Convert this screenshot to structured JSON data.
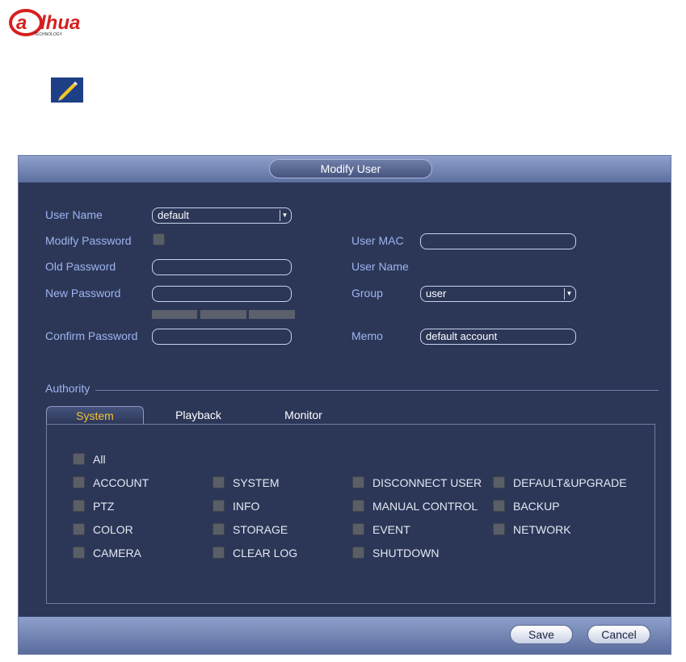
{
  "logo": {
    "brand": "alhua",
    "sub": "TECHNOLOGY",
    "color": "#d62020"
  },
  "dialog": {
    "title": "Modify User",
    "labels": {
      "user_name": "User Name",
      "modify_password": "Modify Password",
      "old_password": "Old Password",
      "new_password": "New Password",
      "confirm_password": "Confirm Password",
      "user_mac": "User MAC",
      "user_name_right": "User Name",
      "group": "Group",
      "memo": "Memo",
      "authority": "Authority"
    },
    "values": {
      "user_name": "default",
      "old_password": "",
      "new_password": "",
      "confirm_password": "",
      "user_mac": "",
      "group": "user",
      "memo": "default account"
    },
    "tabs": [
      "System",
      "Playback",
      "Monitor"
    ],
    "active_tab": "System",
    "permissions": {
      "all": "All",
      "col1": [
        "ACCOUNT",
        "PTZ",
        "COLOR",
        "CAMERA"
      ],
      "col2": [
        "SYSTEM",
        "INFO",
        "STORAGE",
        "CLEAR LOG"
      ],
      "col3": [
        "DISCONNECT USER",
        "MANUAL CONTROL",
        "EVENT",
        "SHUTDOWN"
      ],
      "col4": [
        "DEFAULT&UPGRADE",
        "BACKUP",
        "NETWORK"
      ]
    },
    "buttons": {
      "save": "Save",
      "cancel": "Cancel"
    }
  },
  "icons": {
    "edit": "pencil-icon",
    "dropdown": "chevron-down-icon"
  },
  "colors": {
    "dialog_bg": "#2c3758",
    "label": "#9fb4ee",
    "active_tab": "#f1c232",
    "header": "#7587b8"
  }
}
